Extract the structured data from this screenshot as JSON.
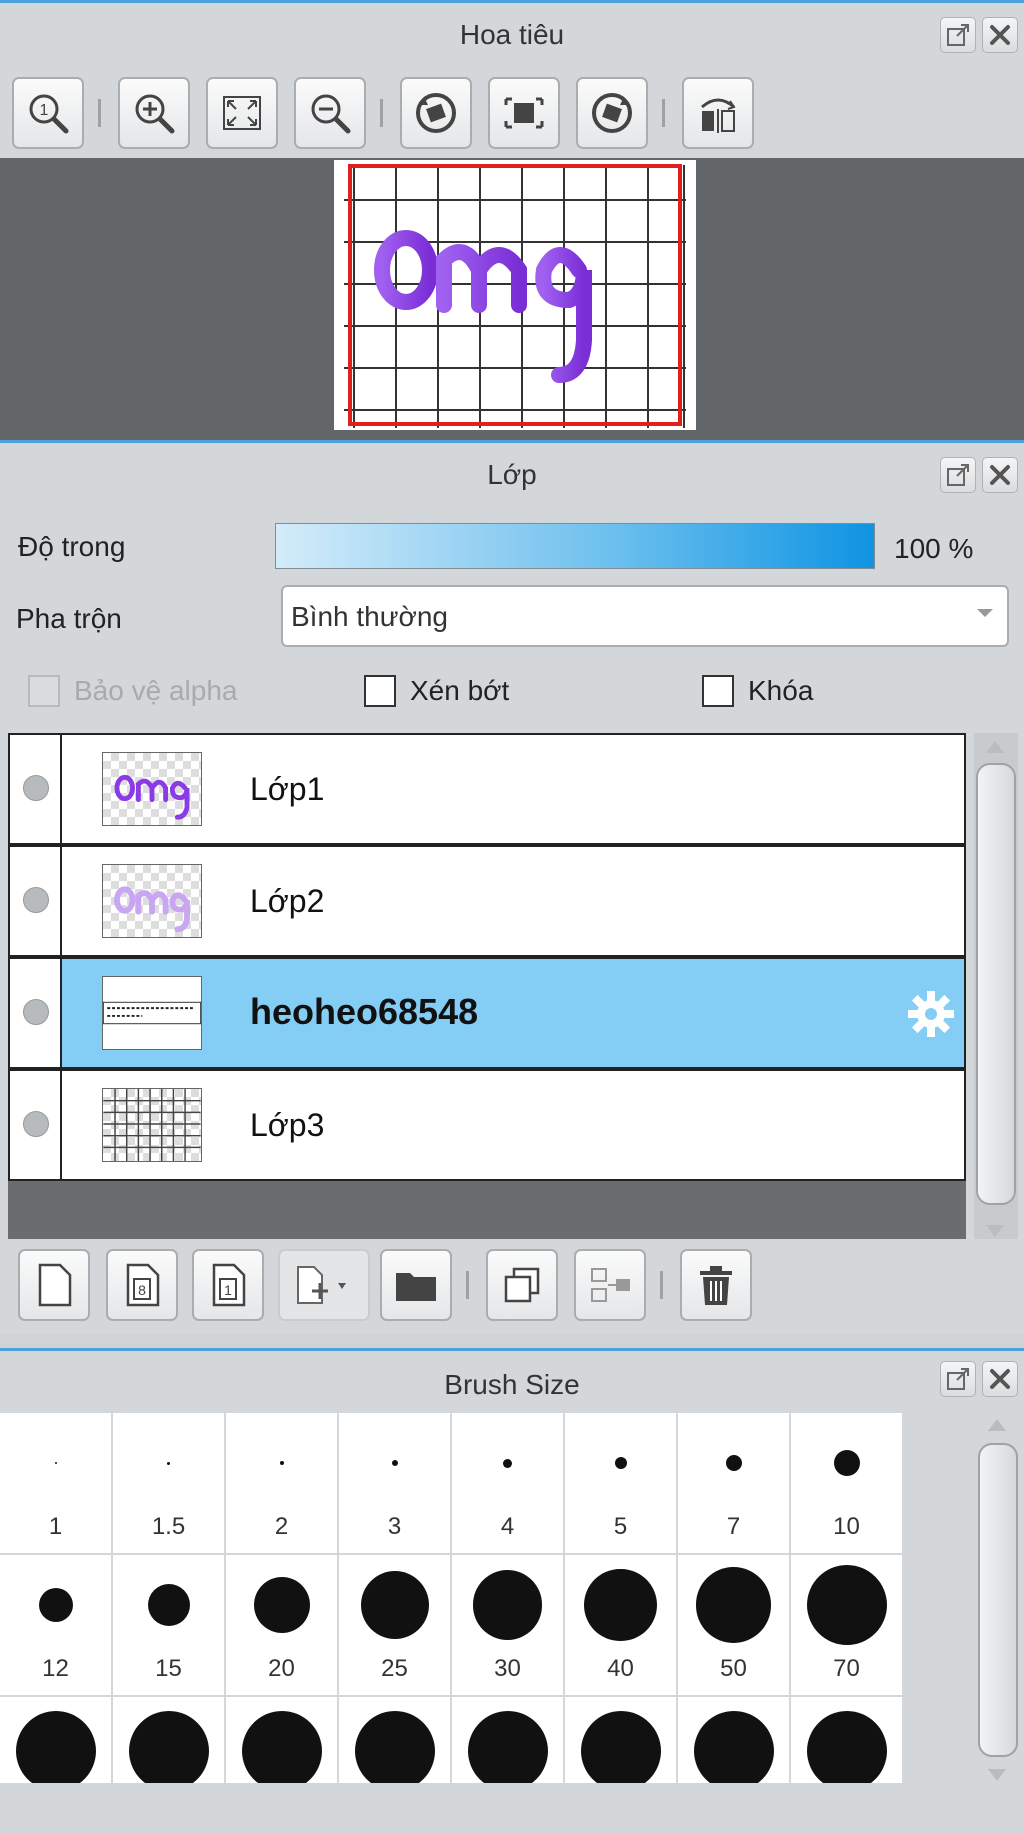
{
  "navigator": {
    "title": "Hoa tiêu",
    "toolbar_icons": [
      "zoom-actual-icon",
      "zoom-in-icon",
      "fit-window-icon",
      "zoom-out-icon",
      "rotate-left-icon",
      "reset-view-icon",
      "rotate-right-icon",
      "flip-icon"
    ]
  },
  "layer_panel": {
    "title": "Lớp",
    "opacity_label": "Độ trong",
    "opacity_value": "100 %",
    "opacity_fraction": 1.0,
    "blend_label": "Pha trộn",
    "blend_value": "Bình thường",
    "protect_alpha_label": "Bảo vệ alpha",
    "clipping_label": "Xén bớt",
    "lock_label": "Khóa",
    "layers": [
      {
        "name": "Lớp1",
        "selected": false
      },
      {
        "name": "Lớp2",
        "selected": false
      },
      {
        "name": "heoheo68548",
        "selected": true
      },
      {
        "name": "Lớp3",
        "selected": false
      }
    ],
    "toolbar_icons": [
      "new-layer-icon",
      "new-8bit-layer-icon",
      "new-1bit-layer-icon",
      "add-layer-dropdown-icon",
      "new-folder-icon",
      "duplicate-layer-icon",
      "merge-down-icon",
      "delete-layer-icon"
    ]
  },
  "brush_panel": {
    "title": "Brush Size",
    "sizes": [
      "1",
      "1.5",
      "2",
      "3",
      "4",
      "5",
      "7",
      "10",
      "12",
      "15",
      "20",
      "25",
      "30",
      "40",
      "50",
      "70"
    ],
    "colors": {
      "accent": "#4aa3d8",
      "selected_row": "#84cdf4"
    }
  }
}
